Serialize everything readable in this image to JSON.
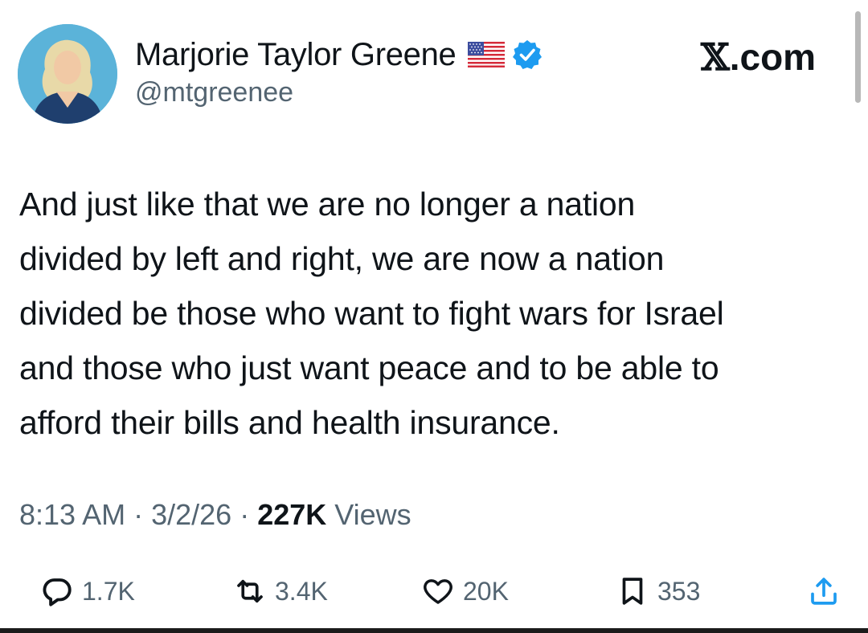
{
  "author": {
    "display_name": "Marjorie Taylor Greene",
    "handle": "@mtgreenee",
    "flag_icon": "us-flag-icon",
    "verified_icon": "verified-badge-icon",
    "verified_color": "#1d9bf0"
  },
  "site": {
    "label_x": "𝕏",
    "label_rest": ".com"
  },
  "tweet": {
    "lines": [
      "And just like that we are no longer a nation",
      "divided by left and right, we are now a nation",
      "divided be those who want to fight wars for Israel",
      "and those who just want peace and to be able to",
      "afford their bills and health insurance."
    ],
    "time": "8:13 AM",
    "date": "3/2/26",
    "separator": " · ",
    "views_count": "227K",
    "views_label": "Views"
  },
  "actions": {
    "reply": {
      "icon": "reply-icon",
      "count": "1.7K"
    },
    "retweet": {
      "icon": "retweet-icon",
      "count": "3.4K"
    },
    "like": {
      "icon": "heart-icon",
      "count": "20K"
    },
    "bookmark": {
      "icon": "bookmark-icon",
      "count": "353"
    },
    "share": {
      "icon": "share-icon"
    }
  },
  "colors": {
    "text": "#0f1419",
    "secondary_text": "#536471",
    "accent": "#1d9bf0",
    "avatar_bg": "#5bb3d9"
  }
}
